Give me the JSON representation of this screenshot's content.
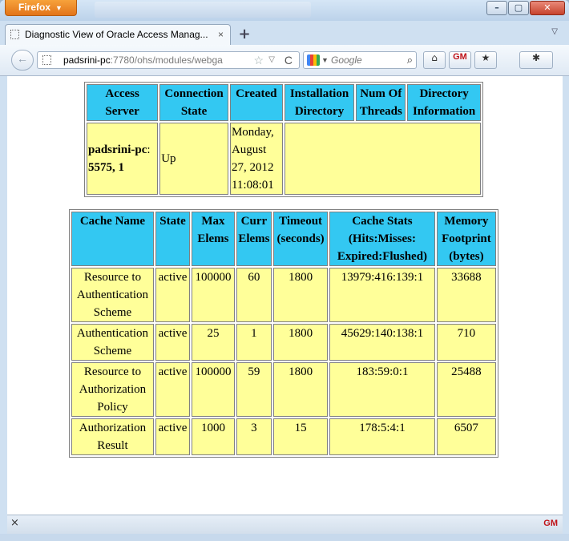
{
  "browser": {
    "app_menu_label": "Firefox",
    "app_menu_arrow": "▼",
    "tab_title": "Diagnostic View of Oracle Access Manag...",
    "tab_close": "×",
    "new_tab": "+",
    "tab_list": "▽",
    "url_host": "padsrini-pc",
    "url_rest": ":7780/ohs/modules/webga",
    "star": "☆",
    "url_drop": "▽",
    "reload": "C",
    "search_placeholder": "Google",
    "search_drop": "▼",
    "search_icon": "⌕",
    "home_icon": "⌂",
    "gm_label": "GM",
    "bookmark_icon": "★",
    "addon_icon": "✱",
    "back_icon": "←",
    "status_close": "×",
    "window_controls": {
      "min": "–",
      "max": "▢",
      "close": "✕"
    }
  },
  "server_table": {
    "headers": [
      "Access Server",
      "Connection State",
      "Created",
      "Installation Directory",
      "Num Of Threads",
      "Directory Information"
    ],
    "row": {
      "server_host": "padsrini-pc",
      "server_port": ":",
      "server_suffix": "5575, 1",
      "state": "Up",
      "created": "Monday, August 27, 2012 11:08:01"
    }
  },
  "cache_table": {
    "headers": [
      "Cache Name",
      "State",
      "Max Elems",
      "Curr Elems",
      "Timeout (seconds)",
      "Cache Stats (Hits:Misses: Expired:Flushed)",
      "Memory Footprint (bytes)"
    ],
    "rows": [
      {
        "name": "Resource to Authentication Scheme",
        "state": "active",
        "max": "100000",
        "curr": "60",
        "timeout": "1800",
        "stats": "13979:416:139:1",
        "memory": "33688"
      },
      {
        "name": "Authentication Scheme",
        "state": "active",
        "max": "25",
        "curr": "1",
        "timeout": "1800",
        "stats": "45629:140:138:1",
        "memory": "710"
      },
      {
        "name": "Resource to Authorization Policy",
        "state": "active",
        "max": "100000",
        "curr": "59",
        "timeout": "1800",
        "stats": "183:59:0:1",
        "memory": "25488"
      },
      {
        "name": "Authorization Result",
        "state": "active",
        "max": "1000",
        "curr": "3",
        "timeout": "15",
        "stats": "178:5:4:1",
        "memory": "6507"
      }
    ]
  }
}
